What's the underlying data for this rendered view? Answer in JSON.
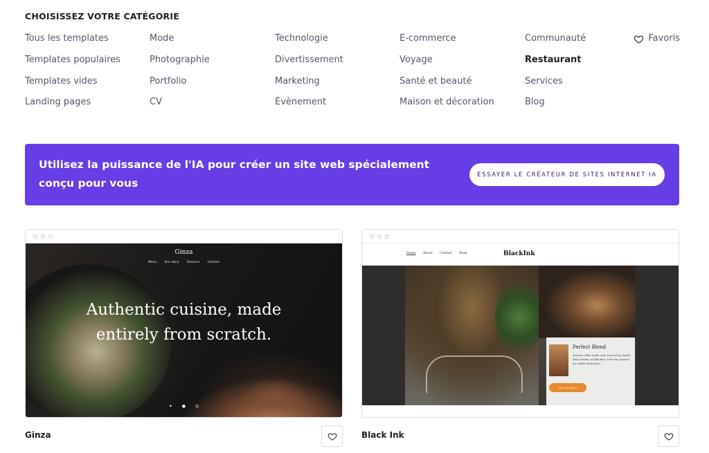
{
  "categories": {
    "title": "CHOISISSEZ VOTRE CATÉGORIE",
    "columns": [
      [
        "Tous les templates",
        "Templates populaires",
        "Templates vides",
        "Landing pages"
      ],
      [
        "Mode",
        "Photographie",
        "Portfolio",
        "CV"
      ],
      [
        "Technologie",
        "Divertissement",
        "Marketing",
        "Évènement"
      ],
      [
        "E-commerce",
        "Voyage",
        "Santé et beauté",
        "Maison et décoration"
      ],
      [
        "Communauté",
        "Restaurant",
        "Services",
        "Blog"
      ]
    ],
    "active": "Restaurant",
    "favorites_label": "Favoris",
    "favorites_icon": "heart-outline-icon"
  },
  "banner": {
    "text": "Utilisez la puissance de l'IA pour créer un site web spécialement conçu pour vous",
    "button_label": "ESSAYER LE CRÉATEUR DE SITES INTERNET IA",
    "color": "#673de6"
  },
  "templates": [
    {
      "name": "Ginza",
      "preview": {
        "logo": "Ginza",
        "nav": [
          "Menu",
          "Our story",
          "Reserve",
          "Contact"
        ],
        "headline": "Authentic cuisine, made entirely from scratch.",
        "social_icons": [
          "twitter-icon",
          "facebook-icon",
          "instagram-icon"
        ]
      }
    },
    {
      "name": "Black Ink",
      "preview": {
        "logo": "BlackInk",
        "nav": [
          "Home",
          "About",
          "Contact",
          "Book"
        ],
        "card_title": "Perfect Blend",
        "card_text": "Artisan coffee made only sourced by suited Mad Artisan, at Blackinc, hear the passion for coffee dedication.",
        "card_button": "Visit our Brand",
        "accent": "#e68a2e"
      }
    }
  ]
}
